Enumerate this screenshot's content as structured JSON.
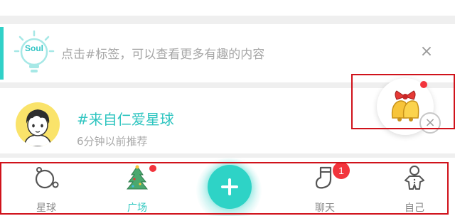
{
  "banner": {
    "logo_text": "Soul",
    "text": "点击#标签，可以查看更多有趣的内容",
    "close_label": "×"
  },
  "recommendation": {
    "tag_title": "#来自仁爱星球",
    "time": "6分钟以前推荐"
  },
  "floating_gift": {
    "close_label": "×"
  },
  "tabbar": {
    "tabs": [
      {
        "label": "星球",
        "icon": "planet-icon"
      },
      {
        "label": "广场",
        "icon": "christmas-tree-icon",
        "active": true
      },
      {
        "label": "",
        "icon": "plus-icon"
      },
      {
        "label": "聊天",
        "icon": "chat-sock-icon",
        "badge": "1"
      },
      {
        "label": "自己",
        "icon": "gingerbread-icon"
      }
    ]
  },
  "colors": {
    "accent": "#31d1c8",
    "badge_red": "#f2343c",
    "annotation_red": "#d0121b"
  }
}
